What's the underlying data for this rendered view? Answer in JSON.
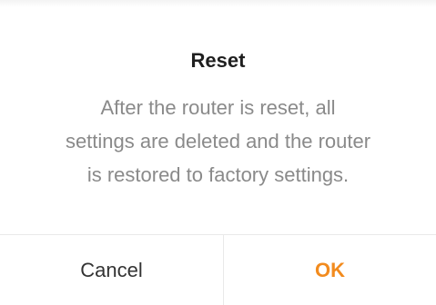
{
  "dialog": {
    "title": "Reset",
    "message_lines": [
      "After the router is reset, all",
      "settings are deleted and the router",
      "is restored to factory settings."
    ],
    "cancel_label": "Cancel",
    "ok_label": "OK"
  },
  "colors": {
    "accent": "#f28b1e",
    "title": "#1f1f1f",
    "message": "#8a8a8a",
    "divider": "#e9e9e9"
  }
}
